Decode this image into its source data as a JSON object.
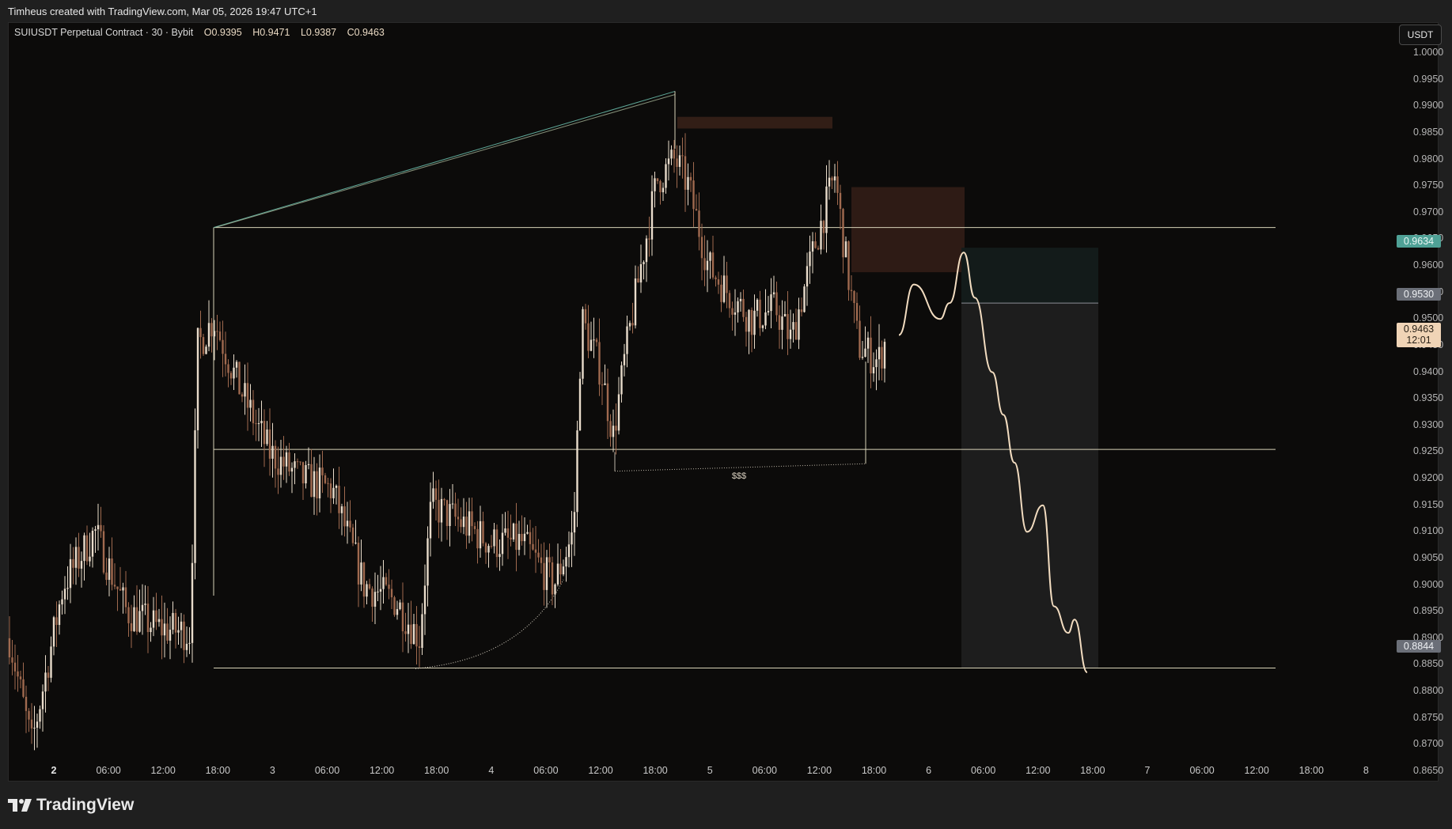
{
  "header": {
    "attribution": "Timheus created with TradingView.com, Mar 05, 2026 19:47 UTC+1"
  },
  "legend": {
    "symbol": "SUIUSDT Perpetual Contract · 30 · Bybit",
    "open": "O0.9395",
    "high": "H0.9471",
    "low": "L0.9387",
    "close": "C0.9463"
  },
  "currency_button": "USDT",
  "price_axis": [
    "1.0000",
    "0.9950",
    "0.9900",
    "0.9850",
    "0.9800",
    "0.9750",
    "0.9700",
    "0.9650",
    "0.9600",
    "0.9550",
    "0.9500",
    "0.9450",
    "0.9400",
    "0.9350",
    "0.9300",
    "0.9250",
    "0.9200",
    "0.9150",
    "0.9100",
    "0.9050",
    "0.9000",
    "0.8950",
    "0.8900",
    "0.8850",
    "0.8800",
    "0.8750",
    "0.8700",
    "0.8650"
  ],
  "time_axis": [
    {
      "label": "2",
      "bold": true
    },
    {
      "label": "06:00"
    },
    {
      "label": "12:00"
    },
    {
      "label": "18:00"
    },
    {
      "label": "3"
    },
    {
      "label": "06:00"
    },
    {
      "label": "12:00"
    },
    {
      "label": "18:00"
    },
    {
      "label": "4"
    },
    {
      "label": "06:00"
    },
    {
      "label": "12:00"
    },
    {
      "label": "18:00"
    },
    {
      "label": "5"
    },
    {
      "label": "06:00"
    },
    {
      "label": "12:00"
    },
    {
      "label": "18:00"
    },
    {
      "label": "6"
    },
    {
      "label": "06:00"
    },
    {
      "label": "12:00"
    },
    {
      "label": "18:00"
    },
    {
      "label": "7"
    },
    {
      "label": "06:00"
    },
    {
      "label": "12:00"
    },
    {
      "label": "18:00"
    },
    {
      "label": "8"
    }
  ],
  "badges": {
    "take_profit": "0.9634",
    "entry": "0.9530",
    "last_price": "0.9463",
    "countdown": "12:01",
    "target": "0.8844"
  },
  "annotations": {
    "liquidity_label": "$$$"
  },
  "colors": {
    "background": "#0c0b0a",
    "candle_up": "#e9dccb",
    "candle_down": "#a06a4f",
    "projection": "#f2dcc0",
    "trendline": "#5fa898",
    "level_line": "#d8d3b8",
    "tp_badge": "#4fa196",
    "entry_badge": "#6b6f78",
    "last_badge": "#f0d4b6"
  },
  "logo": {
    "text": "TradingView"
  },
  "chart_data": {
    "type": "candlestick",
    "symbol": "SUIUSDT Perpetual Contract",
    "interval": "30",
    "exchange": "Bybit",
    "ylim": [
      0.863,
      1.0015
    ],
    "levels": [
      0.9672,
      0.9255,
      0.8844
    ],
    "last": {
      "open": 0.9395,
      "high": 0.9471,
      "low": 0.9387,
      "close": 0.9463
    },
    "zones": [
      {
        "label": "supply",
        "top": 0.988,
        "bottom": 0.9858
      },
      {
        "label": "order block",
        "top": 0.9748,
        "bottom": 0.9588
      },
      {
        "label": "position",
        "entry": 0.953,
        "take_profit": 0.9634,
        "target": 0.8844
      }
    ],
    "trendline": [
      0.9672,
      0.9928
    ],
    "projection": [
      0.947,
      0.9565,
      0.95,
      0.953,
      0.9625,
      0.954,
      0.94,
      0.932,
      0.923,
      0.91,
      0.915,
      0.896,
      0.891,
      0.8935,
      0.8836
    ]
  }
}
